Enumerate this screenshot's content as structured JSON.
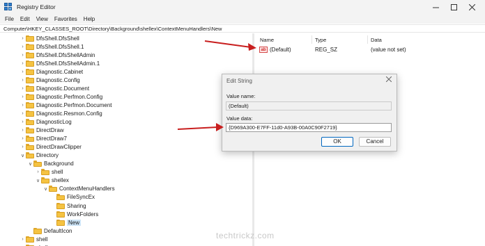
{
  "window": {
    "title": "Registry Editor",
    "minimize_icon": "minimize-icon",
    "maximize_icon": "maximize-icon",
    "close_icon": "close-icon"
  },
  "menu": [
    "File",
    "Edit",
    "View",
    "Favorites",
    "Help"
  ],
  "address": "Computer\\HKEY_CLASSES_ROOT\\Directory\\Background\\shellex\\ContextMenuHandlers\\New",
  "tree": [
    {
      "label": "DfsShell.DfsShell",
      "expandable": true
    },
    {
      "label": "DfsShell.DfsShell.1",
      "expandable": true
    },
    {
      "label": "DfsShell.DfsShellAdmin",
      "expandable": true
    },
    {
      "label": "DfsShell.DfsShellAdmin.1",
      "expandable": true
    },
    {
      "label": "Diagnostic.Cabinet",
      "expandable": true
    },
    {
      "label": "Diagnostic.Config",
      "expandable": true
    },
    {
      "label": "Diagnostic.Document",
      "expandable": true
    },
    {
      "label": "Diagnostic.Perfmon.Config",
      "expandable": true
    },
    {
      "label": "Diagnostic.Perfmon.Document",
      "expandable": true
    },
    {
      "label": "Diagnostic.Resmon.Config",
      "expandable": true
    },
    {
      "label": "DiagnosticLog",
      "expandable": true
    },
    {
      "label": "DirectDraw",
      "expandable": true
    },
    {
      "label": "DirectDraw7",
      "expandable": true
    },
    {
      "label": "DirectDrawClipper",
      "expandable": true
    },
    {
      "label": "Directory",
      "expanded": true
    },
    {
      "label": "Background",
      "expanded": true
    },
    {
      "label": "shell",
      "expandable": true
    },
    {
      "label": "shellex",
      "expanded": true
    },
    {
      "label": "ContextMenuHandlers",
      "expanded": true
    },
    {
      "label": "FileSyncEx"
    },
    {
      "label": "Sharing"
    },
    {
      "label": "WorkFolders"
    },
    {
      "label": "New",
      "selected": true
    },
    {
      "label": "DefaultIcon"
    },
    {
      "label": "shell",
      "expandable": true
    },
    {
      "label": "shellex",
      "expandable": true
    }
  ],
  "list": {
    "columns": [
      "Name",
      "Type",
      "Data"
    ],
    "rows": [
      {
        "name": "(Default)",
        "type": "REG_SZ",
        "data": "(value not set)",
        "icon": "string-value-icon"
      }
    ]
  },
  "dialog": {
    "title": "Edit String",
    "value_name_label": "Value name:",
    "value_name": "(Default)",
    "value_data_label": "Value data:",
    "value_data": "{D969A300-E7FF-11d0-A93B-00A0C90F2719}",
    "ok": "OK",
    "cancel": "Cancel"
  },
  "colors": {
    "arrow": "#c81e1e",
    "selection": "#cce4f7",
    "folder": "#f5c342"
  },
  "watermark": "techtrickz.com"
}
